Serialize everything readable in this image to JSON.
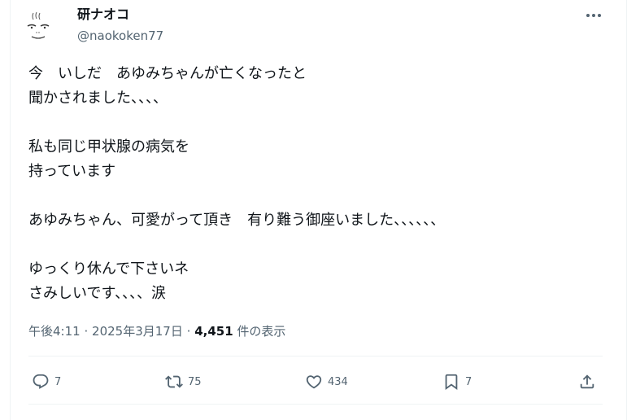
{
  "author": {
    "display_name": "研ナオコ",
    "handle": "@naokoken77"
  },
  "post": {
    "lines": [
      "今　いしだ　あゆみちゃんが亡くなったと",
      "聞かされました、、、、",
      "",
      "私も同じ甲状腺の病気を",
      "持っています",
      "",
      "あゆみちゃん、可愛がって頂き　有り難う御座いました、、、、、、",
      "",
      "ゆっくり休んで下さいネ",
      "さみしいです、、、、涙"
    ],
    "time": "午後4:11",
    "separator": "·",
    "date": "2025年3月17日",
    "views_count": "4,451",
    "views_label": "件の表示"
  },
  "actions": {
    "replies": "7",
    "reposts": "75",
    "likes": "434",
    "bookmarks": "7"
  },
  "icons": [
    "avatar",
    "more-icon",
    "reply-icon",
    "repost-icon",
    "like-icon",
    "bookmark-icon",
    "share-icon"
  ]
}
